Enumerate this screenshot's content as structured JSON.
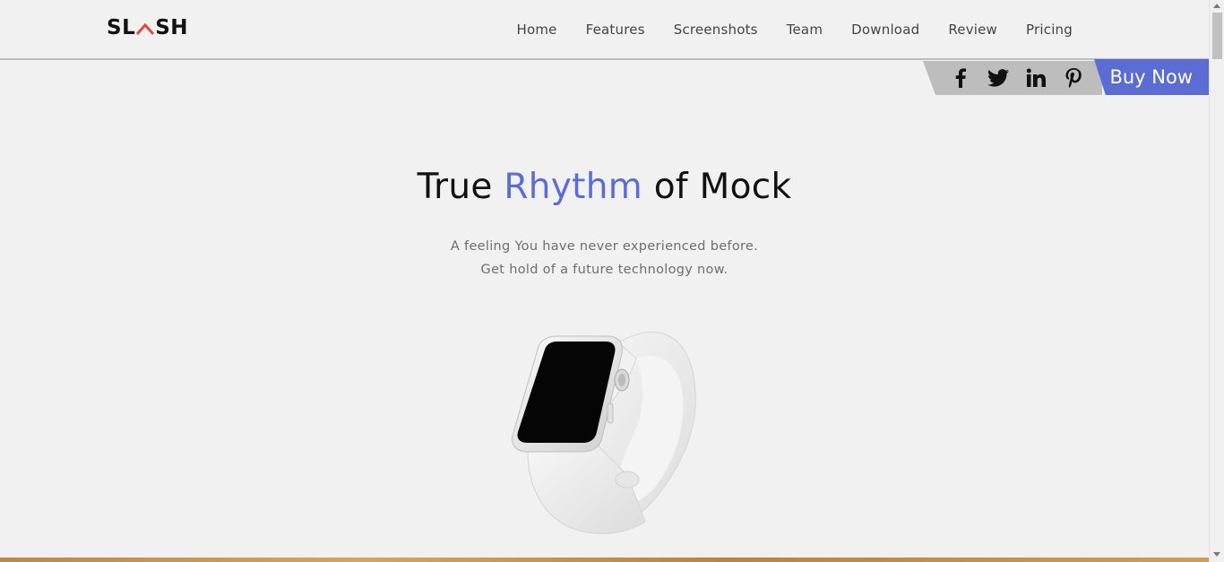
{
  "brand": {
    "logo_left": "SL",
    "logo_right": "SH",
    "logo_mark": "caret-icon"
  },
  "nav": {
    "items": [
      {
        "label": "Home"
      },
      {
        "label": "Features"
      },
      {
        "label": "Screenshots"
      },
      {
        "label": "Team"
      },
      {
        "label": "Download"
      },
      {
        "label": "Review"
      },
      {
        "label": "Pricing"
      }
    ]
  },
  "social": {
    "icons": [
      "facebook-icon",
      "twitter-icon",
      "linkedin-icon",
      "pinterest-icon"
    ]
  },
  "cta": {
    "buy_label": "Buy Now"
  },
  "hero": {
    "title_pre": "True ",
    "title_accent": "Rhythm",
    "title_post": " of Mock",
    "sub_line1": "A feeling You have never experienced before.",
    "sub_line2": "Get hold of a future technology now."
  },
  "colors": {
    "accent": "#5b6dd3",
    "logo_mark": "#e2493c",
    "background": "#f2f1f1",
    "social_strip": "#bdbdbd"
  }
}
